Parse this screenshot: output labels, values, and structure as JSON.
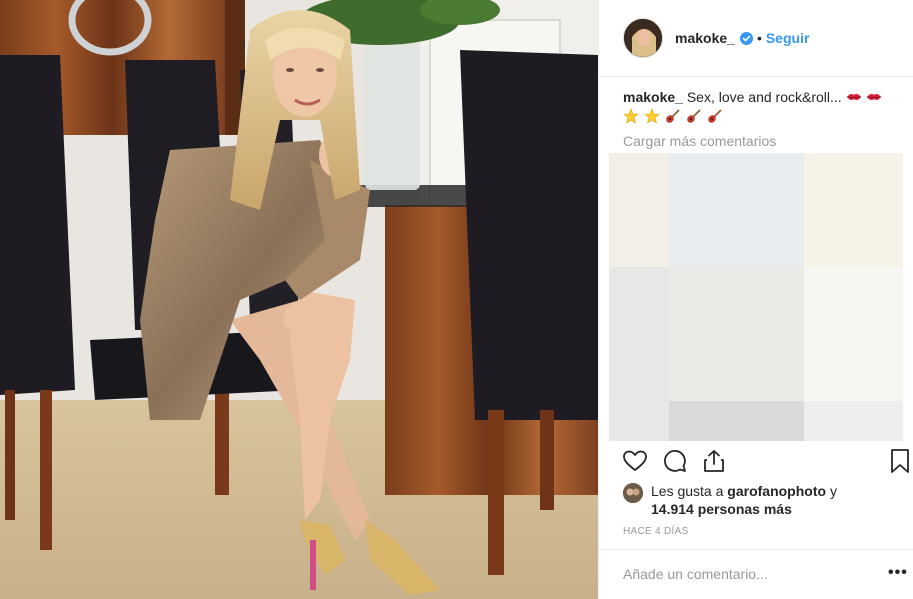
{
  "post": {
    "username": "makoke_",
    "verified": true,
    "follow_label": "Seguir",
    "separator": "•",
    "caption_text": "Sex, love and rock&roll...",
    "caption_emojis": [
      "kiss-mark",
      "kiss-mark",
      "star",
      "star",
      "guitar",
      "guitar",
      "guitar"
    ],
    "load_more_label": "Cargar más comentarios",
    "likes_prefix": "Les gusta a",
    "likes_user": "garofanophoto",
    "likes_and": "y",
    "likes_count": "14.914 personas más",
    "time_ago": "HACE 4 DÍAS",
    "comment_placeholder": "Añade un comentario...",
    "more_label": "•••"
  },
  "icons": {
    "like": "heart-icon",
    "comment": "comment-bubble-icon",
    "share": "share-icon",
    "save": "bookmark-icon",
    "verified": "verified-badge-icon",
    "options": "more-options-icon"
  },
  "colors": {
    "accent": "#3897f0",
    "muted": "#999999",
    "text": "#262626",
    "border": "#efefef"
  }
}
